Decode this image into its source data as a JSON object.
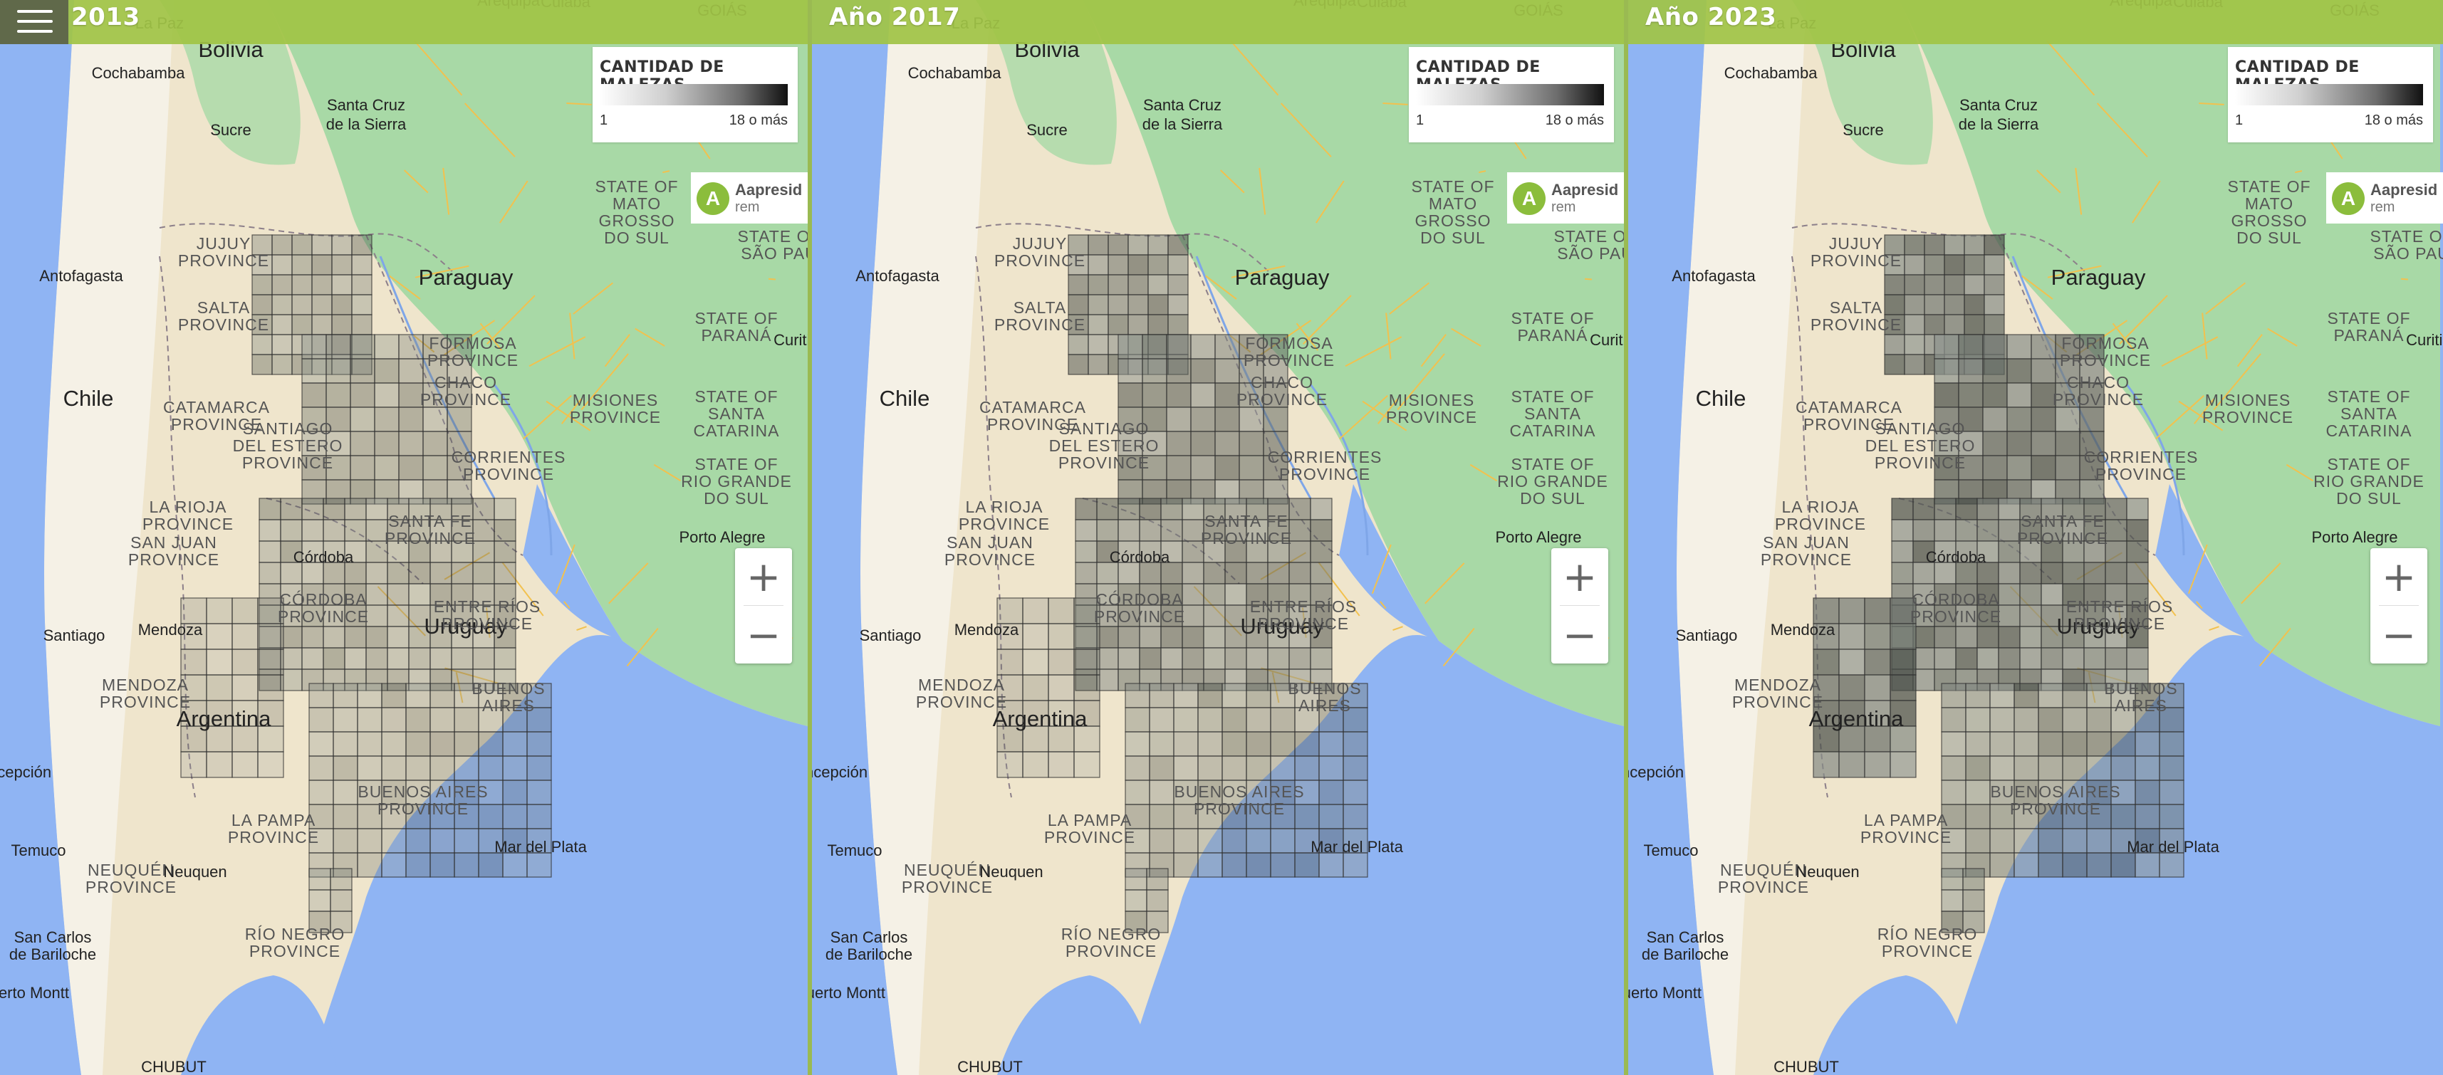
{
  "panels": [
    {
      "title": "2013",
      "show_menu": true,
      "fill_opacity": 0.32,
      "north_opacity": 0.38,
      "west_opacity": 0.22
    },
    {
      "title": "Año 2017",
      "show_menu": false,
      "fill_opacity": 0.4,
      "north_opacity": 0.55,
      "west_opacity": 0.25
    },
    {
      "title": "Año 2023",
      "show_menu": false,
      "fill_opacity": 0.52,
      "north_opacity": 0.72,
      "west_opacity": 0.7
    }
  ],
  "legend": {
    "title": "CANTIDAD DE MALEZAS",
    "min_label": "1",
    "max_label": "18 o más"
  },
  "brand": {
    "name": "Aapresid",
    "sub": "rem",
    "logo_color": "#8bbd3c"
  },
  "zoom": {
    "in_label": "+",
    "out_label": "−"
  },
  "colors": {
    "water": "#8fb4f3",
    "forest": "#a8d9a6",
    "desert": "#efe5cc",
    "andes": "#f5f1e6",
    "header": "#a0c446"
  },
  "map_labels": {
    "countries": [
      "Bolivia",
      "Paraguay",
      "Chile",
      "Uruguay",
      "Argentina"
    ],
    "provinces": [
      [
        "JUJUY",
        "PROVINCE"
      ],
      [
        "SALTA",
        "PROVINCE"
      ],
      [
        "FORMOSA",
        "PROVINCE"
      ],
      [
        "CHACO",
        "PROVINCE"
      ],
      [
        "CATAMARCA",
        "PROVINCE"
      ],
      [
        "SANTIAGO",
        "DEL ESTERO",
        "PROVINCE"
      ],
      [
        "MISIONES",
        "PROVINCE"
      ],
      [
        "CORRIENTES",
        "PROVINCE"
      ],
      [
        "LA RIOJA",
        "PROVINCE"
      ],
      [
        "SAN JUAN",
        "PROVINCE"
      ],
      [
        "SANTA FE",
        "PROVINCE"
      ],
      [
        "CÓRDOBA",
        "PROVINCE"
      ],
      [
        "ENTRE RÍOS",
        "PROVINCE"
      ],
      [
        "MENDOZA",
        "PROVINCE"
      ],
      [
        "BUENOS",
        "AIRES"
      ],
      [
        "LA PAMPA",
        "PROVINCE"
      ],
      [
        "NEUQUÉN",
        "PROVINCE"
      ],
      [
        "RÍO NEGRO",
        "PROVINCE"
      ],
      [
        "BUENOS AIRES",
        "PROVINCE"
      ],
      [
        "STATE OF",
        "MATO",
        "GROSSO",
        "DO SUL"
      ],
      [
        "STATE OF",
        "SÃO PAU"
      ],
      [
        "STATE OF",
        "PARANÁ"
      ],
      [
        "STATE OF",
        "SANTA",
        "CATARINA"
      ],
      [
        "STATE OF",
        "RIO GRANDE",
        "DO SUL"
      ]
    ],
    "cities": [
      "La Paz",
      "Cuiabá",
      "GOIÁS",
      "Cochabamba",
      "Santa Cruz",
      "de la Sierra",
      "Sucre",
      "Arequipa",
      "Antofagasta",
      "Curitiba",
      "Córdoba",
      "Porto Alegre",
      "Santiago",
      "Mendoza",
      "Mar del Plata",
      "Temuco",
      "Neuquen",
      "San Carlos",
      "de Bariloche",
      "Puerto Montt",
      "CHUBUT",
      "Concepción"
    ]
  }
}
